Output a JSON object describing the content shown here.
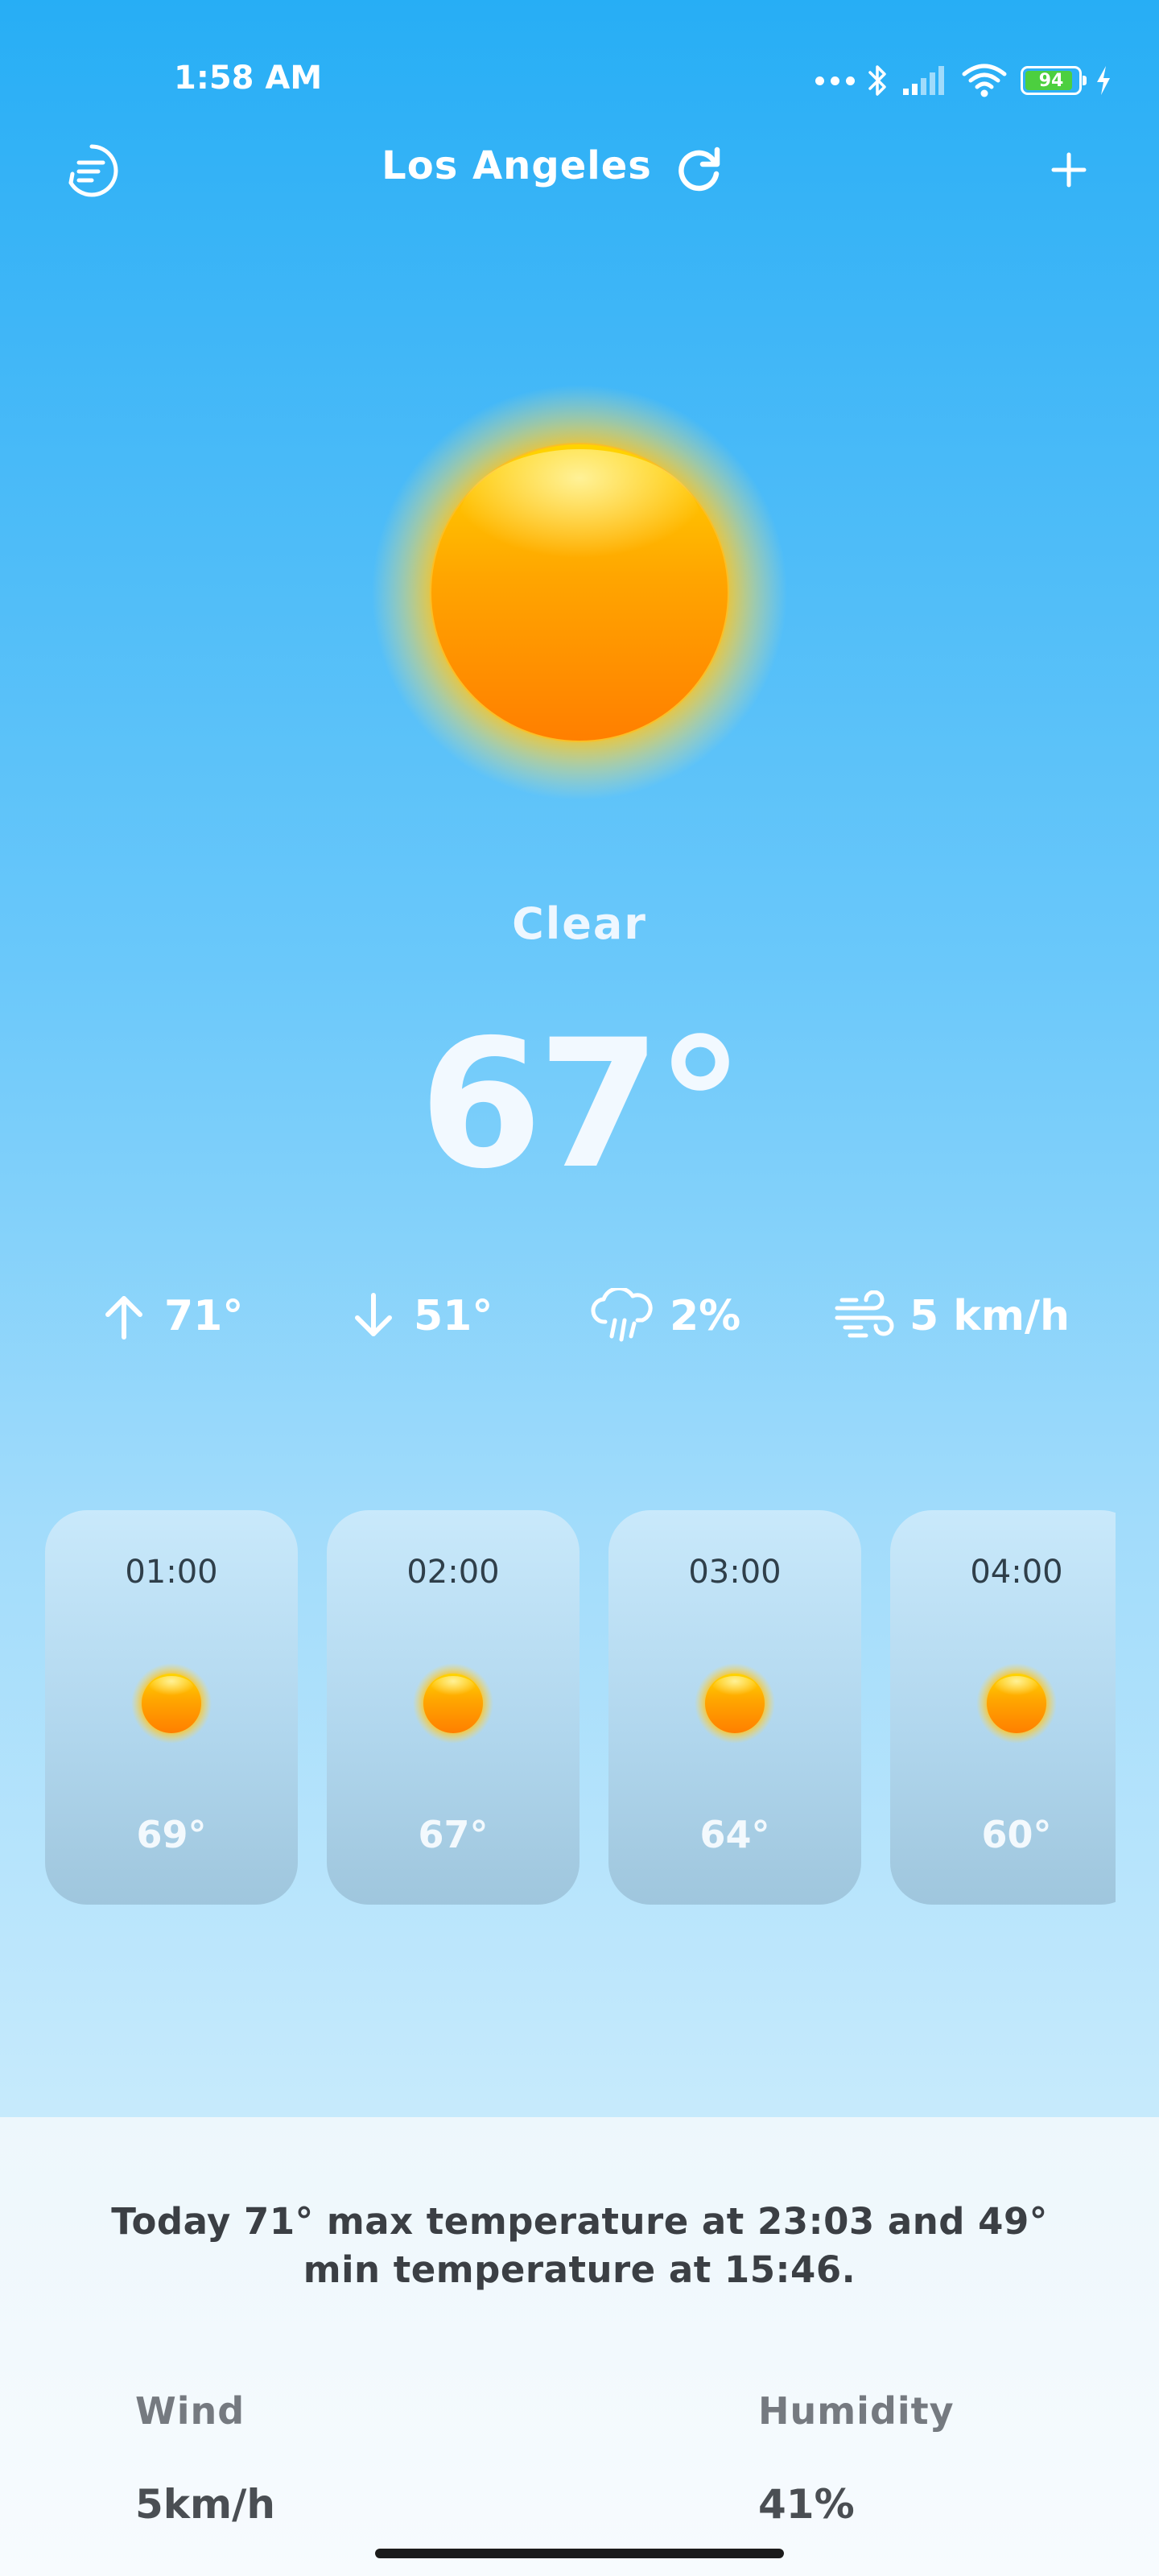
{
  "status_bar": {
    "time": "1:58 AM",
    "battery_level": "94",
    "icons": [
      "more-dots-icon",
      "bluetooth-icon",
      "signal-icon",
      "wifi-icon",
      "battery-icon",
      "charging-icon"
    ]
  },
  "header": {
    "city": "Los Angeles",
    "menu_icon": "menu-circle-icon",
    "refresh_icon": "refresh-icon",
    "add_icon": "plus-icon"
  },
  "current": {
    "icon": "sun-icon",
    "condition": "Clear",
    "temperature": "67°"
  },
  "stats": {
    "high": "71°",
    "low": "51°",
    "precipitation": "2%",
    "wind": "5 km/h"
  },
  "hourly": [
    {
      "time": "01:00",
      "icon": "sun-icon",
      "temp": "69°"
    },
    {
      "time": "02:00",
      "icon": "sun-icon",
      "temp": "67°"
    },
    {
      "time": "03:00",
      "icon": "sun-icon",
      "temp": "64°"
    },
    {
      "time": "04:00",
      "icon": "sun-icon",
      "temp": "60°"
    }
  ],
  "summary": {
    "text": "Today 71° max temperature at 23:03 and 49° min temperature at 15:46."
  },
  "details": {
    "wind_label": "Wind",
    "wind_value": "5km/h",
    "humidity_label": "Humidity",
    "humidity_value": "41%"
  },
  "colors": {
    "sky_top": "#27aef5",
    "sky_bottom": "#c6eafc",
    "sun_core": "#ff8a00",
    "sun_glow": "#ffd21a",
    "panel": "#f4fafd"
  }
}
